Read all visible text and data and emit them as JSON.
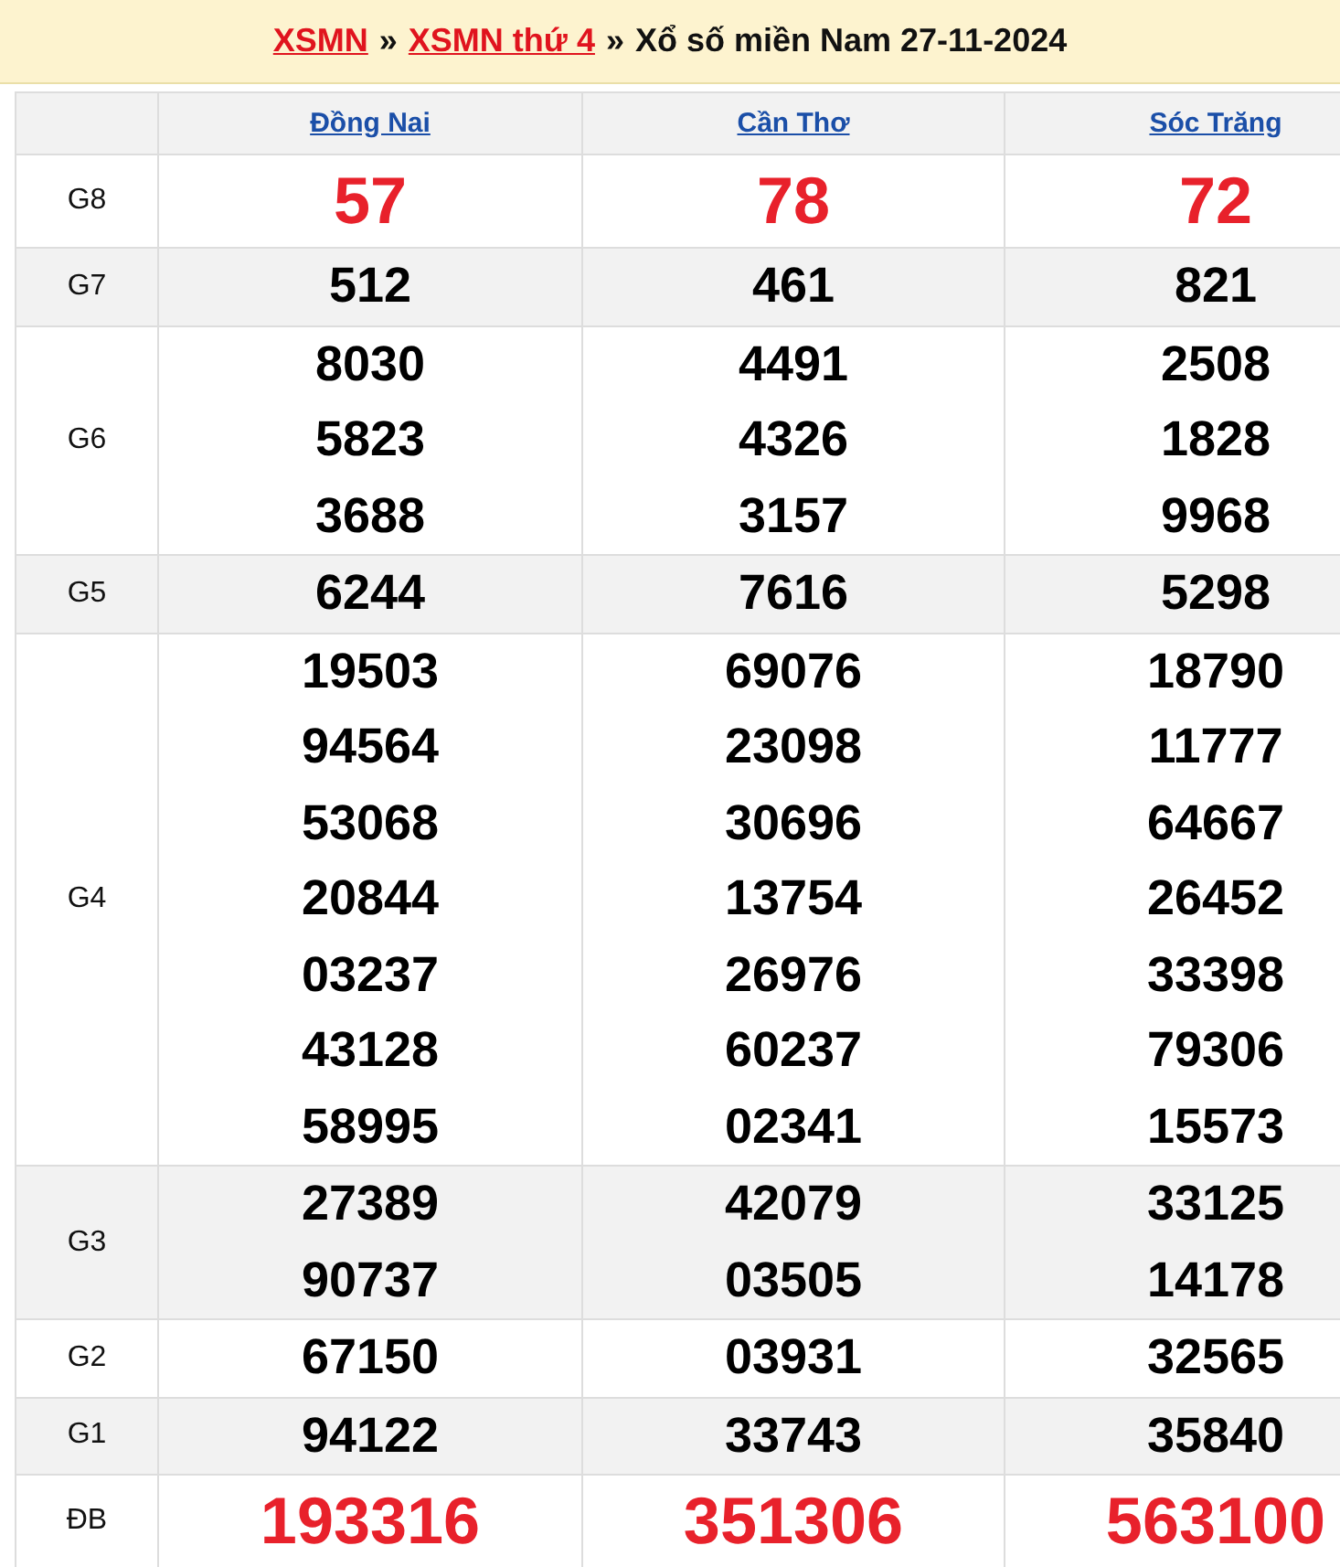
{
  "breadcrumb": [
    {
      "kind": "link",
      "text": "XSMN"
    },
    {
      "kind": "separator",
      "text": "»"
    },
    {
      "kind": "link",
      "text": "XSMN thứ 4"
    },
    {
      "kind": "separator",
      "text": "»"
    },
    {
      "kind": "title",
      "text": "Xổ số miền Nam 27-11-2024"
    }
  ],
  "table": {
    "columns": [
      "Đồng Nai",
      "Cần Thơ",
      "Sóc Trăng"
    ],
    "rows": [
      {
        "prize": "G8",
        "kind": "highlight",
        "values": [
          [
            "57"
          ],
          [
            "78"
          ],
          [
            "72"
          ]
        ]
      },
      {
        "prize": "G7",
        "kind": "normal",
        "values": [
          [
            "512"
          ],
          [
            "461"
          ],
          [
            "821"
          ]
        ]
      },
      {
        "prize": "G6",
        "kind": "normal",
        "values": [
          [
            "8030",
            "5823",
            "3688"
          ],
          [
            "4491",
            "4326",
            "3157"
          ],
          [
            "2508",
            "1828",
            "9968"
          ]
        ]
      },
      {
        "prize": "G5",
        "kind": "normal",
        "values": [
          [
            "6244"
          ],
          [
            "7616"
          ],
          [
            "5298"
          ]
        ]
      },
      {
        "prize": "G4",
        "kind": "normal",
        "values": [
          [
            "19503",
            "94564",
            "53068",
            "20844",
            "03237",
            "43128",
            "58995"
          ],
          [
            "69076",
            "23098",
            "30696",
            "13754",
            "26976",
            "60237",
            "02341"
          ],
          [
            "18790",
            "11777",
            "64667",
            "26452",
            "33398",
            "79306",
            "15573"
          ]
        ]
      },
      {
        "prize": "G3",
        "kind": "normal",
        "values": [
          [
            "27389",
            "90737"
          ],
          [
            "42079",
            "03505"
          ],
          [
            "33125",
            "14178"
          ]
        ]
      },
      {
        "prize": "G2",
        "kind": "normal",
        "values": [
          [
            "67150"
          ],
          [
            "03931"
          ],
          [
            "32565"
          ]
        ]
      },
      {
        "prize": "G1",
        "kind": "normal",
        "values": [
          [
            "94122"
          ],
          [
            "33743"
          ],
          [
            "35840"
          ]
        ]
      },
      {
        "prize": "ĐB",
        "kind": "highlight",
        "values": [
          [
            "193316"
          ],
          [
            "351306"
          ],
          [
            "563100"
          ]
        ]
      }
    ]
  }
}
